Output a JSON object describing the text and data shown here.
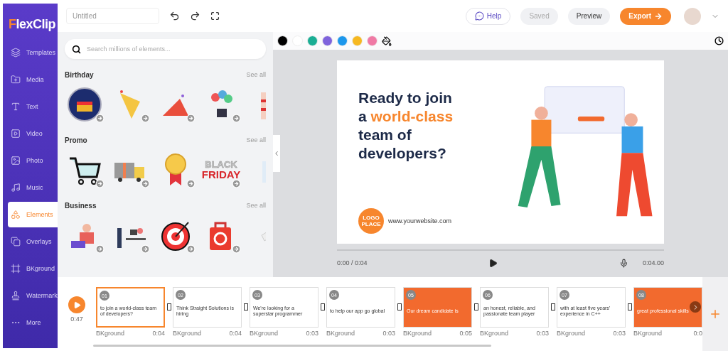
{
  "logo": {
    "first": "F",
    "rest": "lexClip"
  },
  "title_field": {
    "placeholder": "Untitled"
  },
  "header_buttons": [
    {
      "kind": "help",
      "label": "Help"
    },
    {
      "kind": "plain",
      "label": "Saved",
      "disabled": true
    },
    {
      "kind": "plain",
      "label": "Preview",
      "disabled": false
    },
    {
      "kind": "export",
      "label": "Export"
    }
  ],
  "sidebar": {
    "items": [
      {
        "label": "Templates",
        "selected": false
      },
      {
        "label": "Media",
        "selected": false
      },
      {
        "label": "Text",
        "selected": false
      },
      {
        "label": "Video",
        "selected": false
      },
      {
        "label": "Photo",
        "selected": false
      },
      {
        "label": "Music",
        "selected": false
      },
      {
        "label": "Elements",
        "selected": true
      },
      {
        "label": "Overlays",
        "selected": false
      },
      {
        "label": "BKground",
        "selected": false
      },
      {
        "label": "Watermark",
        "selected": false
      },
      {
        "label": "More",
        "selected": false
      }
    ]
  },
  "elements_panel": {
    "search": {
      "placeholder": "Search millions of elements..."
    },
    "categories": [
      {
        "title": "Birthday",
        "link": "See all",
        "items": [
          {
            "kind": "cake-badge"
          },
          {
            "kind": "popper"
          },
          {
            "kind": "party-hat"
          },
          {
            "kind": "balloons-gift"
          },
          {
            "kind": "cake-slice"
          }
        ]
      },
      {
        "title": "Promo",
        "link": "See all",
        "items": [
          {
            "kind": "cart"
          },
          {
            "kind": "gift-truck"
          },
          {
            "kind": "medal"
          },
          {
            "kind": "sale-text",
            "texts": [
              "BLACK",
              "FRIDAY"
            ]
          },
          {
            "kind": "cone"
          }
        ]
      },
      {
        "title": "Business",
        "link": "See all",
        "items": [
          {
            "kind": "person-laptop"
          },
          {
            "kind": "office"
          },
          {
            "kind": "target"
          },
          {
            "kind": "bag"
          },
          {
            "kind": "paper"
          }
        ]
      }
    ]
  },
  "color_bar": {
    "swatches": [
      {
        "color": "#000000"
      },
      {
        "color": "#ffffff"
      },
      {
        "color": "#1aae94"
      },
      {
        "color": "#7f63dc"
      },
      {
        "color": "#1c97ec"
      },
      {
        "color": "#f6b820"
      },
      {
        "color": "#f07aa5"
      }
    ]
  },
  "slide": {
    "heading_lines": [
      [
        {
          "text": "Ready to join",
          "accent": false
        }
      ],
      [
        {
          "text": "a ",
          "accent": false
        },
        {
          "text": "world-class",
          "accent": true
        }
      ],
      [
        {
          "text": "team of",
          "accent": false
        }
      ],
      [
        {
          "text": "developers?",
          "accent": false
        }
      ]
    ],
    "logo_text": "LOGO PLACE",
    "website": "www.yourwebsite.com"
  },
  "player": {
    "time": "0:00 / 0:04",
    "level": 0,
    "duration": "0:04.00"
  },
  "timeline": {
    "total": "0:47",
    "clips": [
      {
        "number": "01",
        "kind": "white",
        "text": "to join a world-class team of developers?",
        "caption": "BKground",
        "duration": "0:04",
        "selected": true
      },
      {
        "number": "02",
        "kind": "white",
        "text": "Think Straight Solutions is hiring",
        "caption": "BKground",
        "duration": "0:04",
        "selected": false
      },
      {
        "number": "03",
        "kind": "white",
        "text": "We're looking for a superstar programmer",
        "caption": "BKground",
        "duration": "0:03",
        "selected": false
      },
      {
        "number": "04",
        "kind": "white",
        "text": "to help our app go global",
        "caption": "BKground",
        "duration": "0:03",
        "selected": false
      },
      {
        "number": "05",
        "kind": "orange",
        "text": "Our dream candidate is",
        "caption": "BKground",
        "duration": "0:05",
        "selected": false
      },
      {
        "number": "06",
        "kind": "white",
        "text": "an honest, reliable, and passionate team player",
        "caption": "BKground",
        "duration": "0:03",
        "selected": false
      },
      {
        "number": "07",
        "kind": "white",
        "text": "with at least five years' experience in C++",
        "caption": "BKground",
        "duration": "0:03",
        "selected": false
      },
      {
        "number": "08",
        "kind": "orange",
        "text": "great professional skills",
        "caption": "BKground",
        "duration": "0:0",
        "selected": false
      }
    ]
  }
}
